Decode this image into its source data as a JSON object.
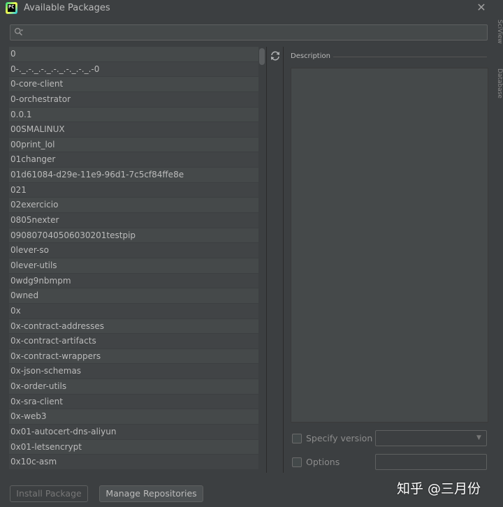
{
  "window": {
    "title": "Available Packages",
    "close_icon": "close-icon"
  },
  "side_tabs": [
    "SciView",
    "Database"
  ],
  "search": {
    "value": "",
    "placeholder": ""
  },
  "packages": [
    "0",
    "0-._.-._.-._.-._.-._.-._.-0",
    "0-core-client",
    "0-orchestrator",
    "0.0.1",
    "00SMALINUX",
    "00print_lol",
    "01changer",
    "01d61084-d29e-11e9-96d1-7c5cf84ffe8e",
    "021",
    "02exercicio",
    "0805nexter",
    "090807040506030201testpip",
    "0lever-so",
    "0lever-utils",
    "0wdg9nbmpm",
    "0wned",
    "0x",
    "0x-contract-addresses",
    "0x-contract-artifacts",
    "0x-contract-wrappers",
    "0x-json-schemas",
    "0x-order-utils",
    "0x-sra-client",
    "0x-web3",
    "0x01-autocert-dns-aliyun",
    "0x01-letsencrypt",
    "0x10c-asm"
  ],
  "description": {
    "label": "Description",
    "text": ""
  },
  "specify_version": {
    "label": "Specify version",
    "checked": false,
    "selected": ""
  },
  "options": {
    "label": "Options",
    "checked": false,
    "value": ""
  },
  "buttons": {
    "install": "Install Package",
    "manage": "Manage Repositories"
  },
  "watermark": "知乎 @三月份"
}
